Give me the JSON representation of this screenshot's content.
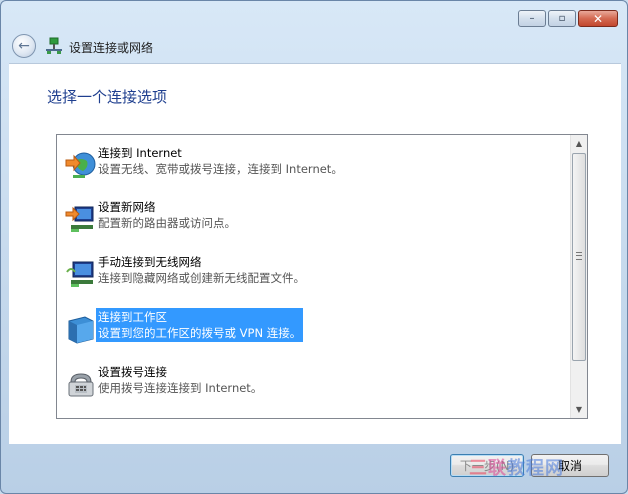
{
  "window": {
    "title": "设置连接或网络",
    "minimize_glyph": "–",
    "maximize_glyph": "▫",
    "close_glyph": "✕",
    "back_glyph": "←"
  },
  "page": {
    "heading": "选择一个连接选项"
  },
  "options": [
    {
      "title": "连接到 Internet",
      "desc": "设置无线、宽带或拨号连接，连接到 Internet。",
      "icon": "globe-network-icon"
    },
    {
      "title": "设置新网络",
      "desc": "配置新的路由器或访问点。",
      "icon": "new-network-icon"
    },
    {
      "title": "手动连接到无线网络",
      "desc": "连接到隐藏网络或创建新无线配置文件。",
      "icon": "wireless-network-icon"
    },
    {
      "title": "连接到工作区",
      "desc": "设置到您的工作区的拨号或 VPN 连接。",
      "icon": "workplace-icon",
      "selected": true
    },
    {
      "title": "设置拨号连接",
      "desc": "使用拨号连接连接到 Internet。",
      "icon": "dialup-phone-icon"
    }
  ],
  "scrollbar": {
    "up": "▲",
    "down": "▼"
  },
  "buttons": {
    "next": "下一步(N)",
    "cancel": "取消"
  },
  "watermark": {
    "p1": "三",
    "p2": "联",
    "p3": "教程网"
  }
}
